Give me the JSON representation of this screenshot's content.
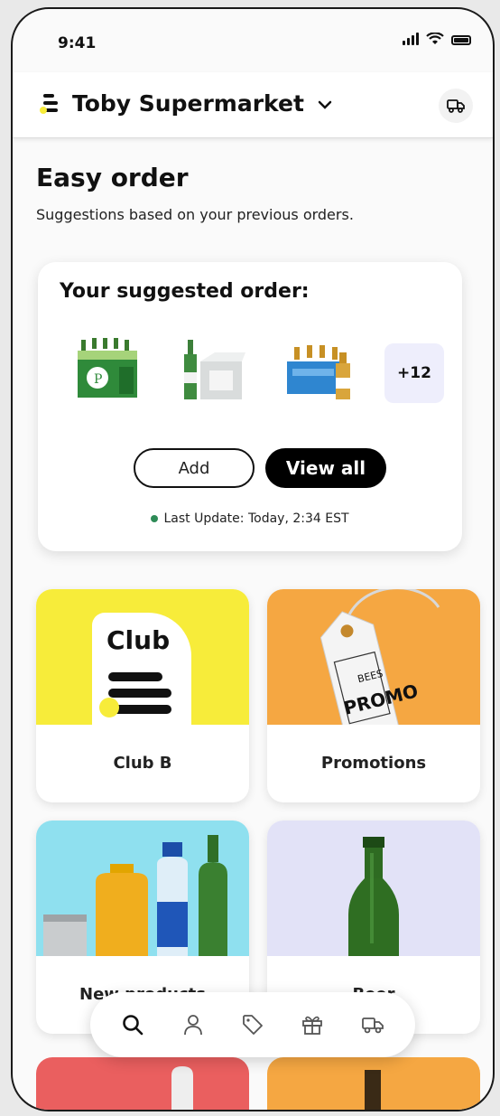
{
  "status": {
    "time": "9:41"
  },
  "header": {
    "store_name": "Toby Supermarket"
  },
  "intro": {
    "title": "Easy order",
    "subtitle": "Suggestions based on your previous orders."
  },
  "suggested": {
    "title": "Your suggested order:",
    "more_count": "+12",
    "add_label": "Add",
    "view_all_label": "View all",
    "last_update": "Last Update: Today, 2:34 EST"
  },
  "tiles": [
    {
      "label": "Club B"
    },
    {
      "label": "Promotions"
    },
    {
      "label": "New products"
    },
    {
      "label": "Beer"
    }
  ],
  "club_text": "Club",
  "promo_text": {
    "brand": "BEES",
    "word": "PROMO"
  },
  "colors": {
    "club_bg": "#f7ec3a",
    "promo_bg": "#f5a742",
    "new_bg": "#8fe0ef",
    "beer_bg": "#e2e2f7",
    "peek_left": "#ea5f5f",
    "peek_right": "#f5a742",
    "update_dot": "#2e8b57"
  },
  "nav_icons": [
    "search-icon",
    "profile-icon",
    "tag-icon",
    "gift-icon",
    "truck-icon"
  ]
}
